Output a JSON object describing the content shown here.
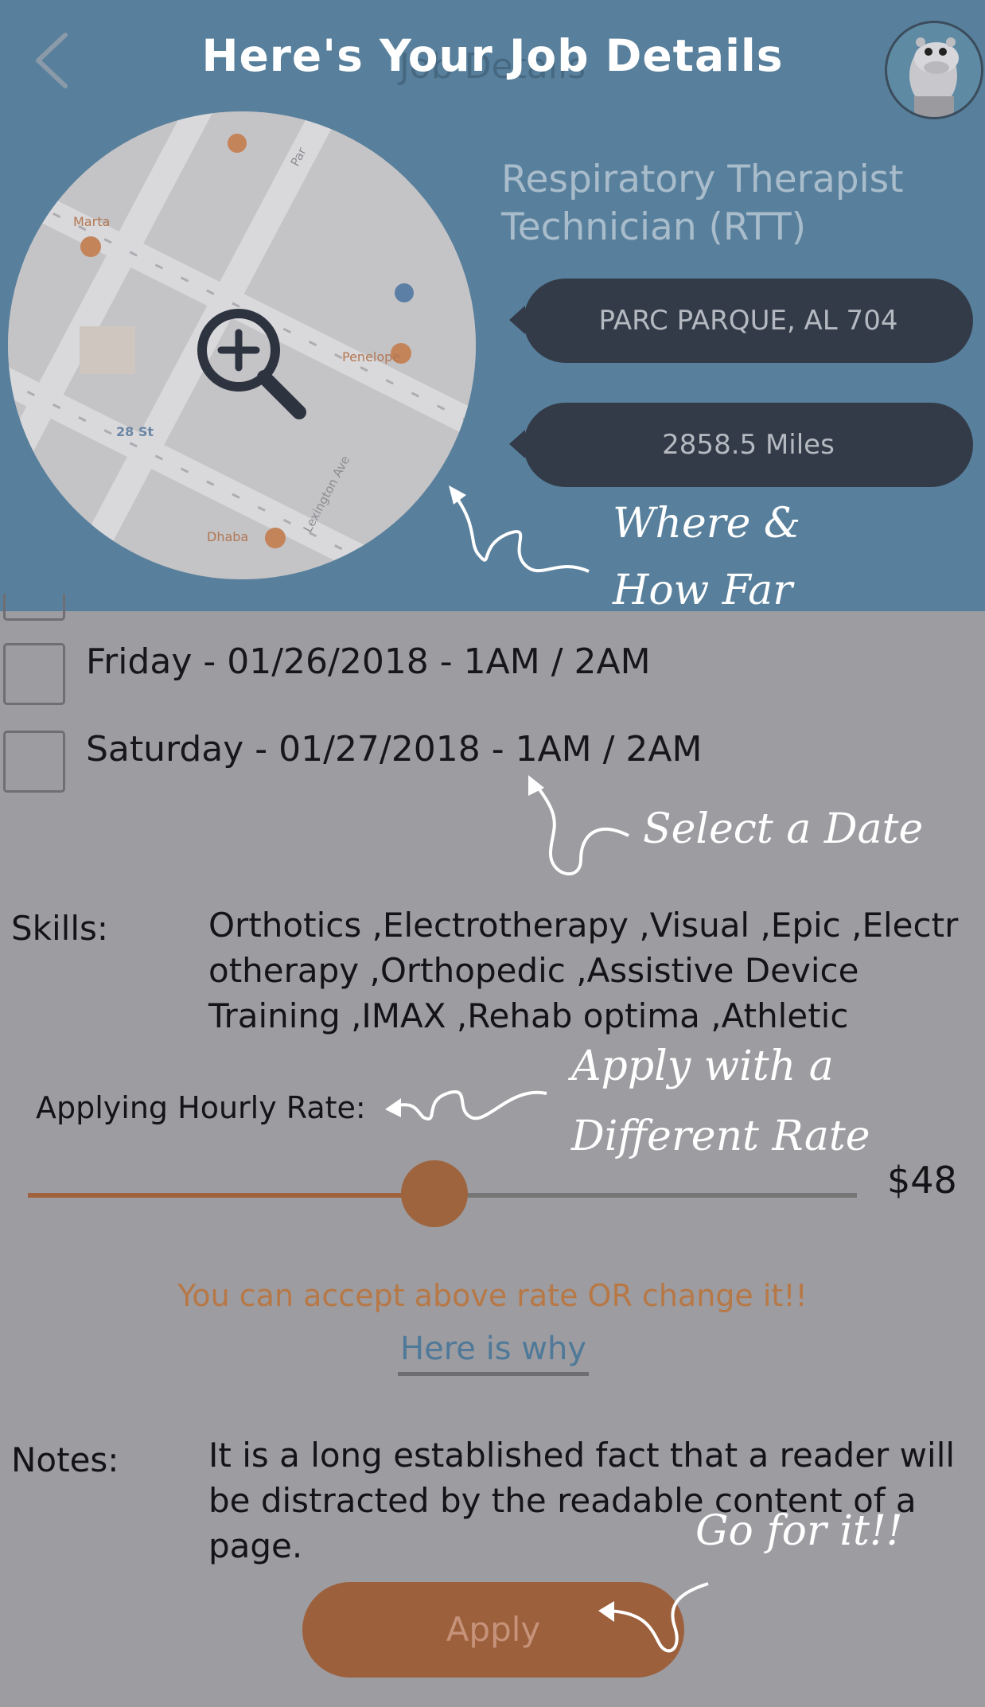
{
  "header": {
    "title": "Here's Your Job Details",
    "ghost_title": "Job Details",
    "back_icon": "chevron-left-icon",
    "avatar_icon": "hippo-mascot-avatar"
  },
  "job": {
    "title": "Respiratory Therapist Technician (RTT)",
    "location": "PARC PARQUE, AL 704",
    "distance": "2858.5 Miles"
  },
  "map": {
    "labels": [
      "Marta",
      "Penelope",
      "28 St",
      "Dhaba",
      "Lexington Ave",
      "Par"
    ]
  },
  "annotations": {
    "where": "Where &",
    "how_far": "How Far",
    "select_date": "Select a Date",
    "apply_rate_1": "Apply with a",
    "apply_rate_2": "Different Rate",
    "go_for_it": "Go for it!!"
  },
  "dates": [
    {
      "label": "Friday - 01/26/2018 - 1AM  / 2AM",
      "checked": false
    },
    {
      "label": "Saturday - 01/27/2018 - 1AM  / 2AM",
      "checked": false
    }
  ],
  "skills": {
    "label": "Skills:",
    "line1": "Orthotics ,Electrotherapy ,Visual ,Epic ,Electr",
    "line2": "otherapy ,Orthopedic ,Assistive Device",
    "line3": "Training ,IMAX ,Rehab optima ,Athletic"
  },
  "rate": {
    "label": "Applying Hourly Rate:",
    "value": "$48",
    "slider_fraction": 0.49,
    "accept_text": "You can accept above rate OR change it!!",
    "why_link": "Here is why"
  },
  "notes": {
    "label": "Notes:",
    "line1": "It is a long established fact that a reader will",
    "line2": "be distracted by the readable content of a",
    "line3": "page."
  },
  "apply": {
    "label": "Apply"
  },
  "colors": {
    "header_bg": "#58809c",
    "page_bg": "#9d9ca1",
    "pill_bg": "#333b49",
    "accent": "#9c603c",
    "link": "#4f7998"
  }
}
